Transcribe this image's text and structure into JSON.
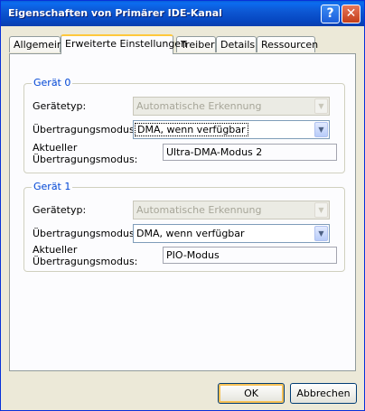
{
  "window": {
    "title": "Eigenschaften von Primärer IDE-Kanal",
    "help_label": "?",
    "close_label": "✕"
  },
  "tabs": [
    {
      "label": "Allgemein"
    },
    {
      "label": "Erweiterte Einstellungen",
      "active": true
    },
    {
      "label": "Treiber"
    },
    {
      "label": "Details"
    },
    {
      "label": "Ressourcen"
    }
  ],
  "devices": [
    {
      "title": "Gerät 0",
      "type_label": "Gerätetyp:",
      "type_value": "Automatische Erkennung",
      "mode_label": "Übertragungsmodus:",
      "mode_value": "DMA, wenn verfügbar",
      "current_label_1": "Aktueller",
      "current_label_2": "Übertragungsmodus:",
      "current_value": "Ultra-DMA-Modus 2"
    },
    {
      "title": "Gerät 1",
      "type_label": "Gerätetyp:",
      "type_value": "Automatische Erkennung",
      "mode_label": "Übertragungsmodus:",
      "mode_value": "DMA, wenn verfügbar",
      "current_label_1": "Aktueller",
      "current_label_2": "Übertragungsmodus:",
      "current_value": "PIO-Modus"
    }
  ],
  "buttons": {
    "ok": "OK",
    "cancel": "Abbrechen"
  },
  "icons": {
    "help": "help-icon",
    "close": "close-icon",
    "dropdown": "chevron-down-icon"
  },
  "colors": {
    "titlebar": "#0A5FD8",
    "group_title": "#0046D5",
    "active_tab_accent": "#FFC83C",
    "close_button": "#C33E18"
  }
}
